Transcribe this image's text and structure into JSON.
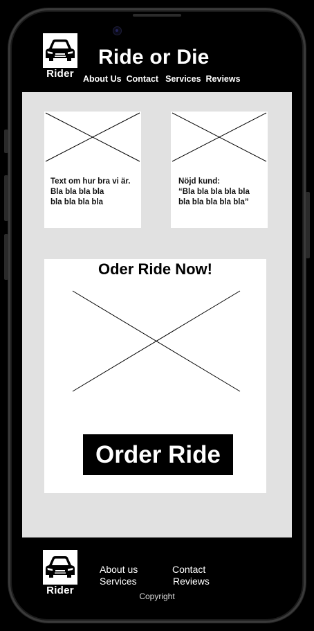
{
  "header": {
    "logo_text": "Rider",
    "title": "Ride or Die",
    "nav": [
      "About Us",
      "Contact",
      "Services",
      "Reviews"
    ]
  },
  "cards": [
    {
      "text": "Text om hur bra vi är.\nBla bla bla bla\nbla bla bla bla"
    },
    {
      "text": "Nöjd kund:\n“Bla bla bla bla bla\nbla bla bla bla bla”"
    }
  ],
  "order": {
    "heading": "Oder Ride Now!",
    "button_label": "Order Ride"
  },
  "footer": {
    "logo_text": "Rider",
    "links": [
      "About us",
      "Contact",
      "Services",
      "Reviews"
    ],
    "copyright": "Copyright"
  },
  "colors": {
    "background": "#000000",
    "content": "#e1e1e1",
    "card": "#ffffff"
  }
}
